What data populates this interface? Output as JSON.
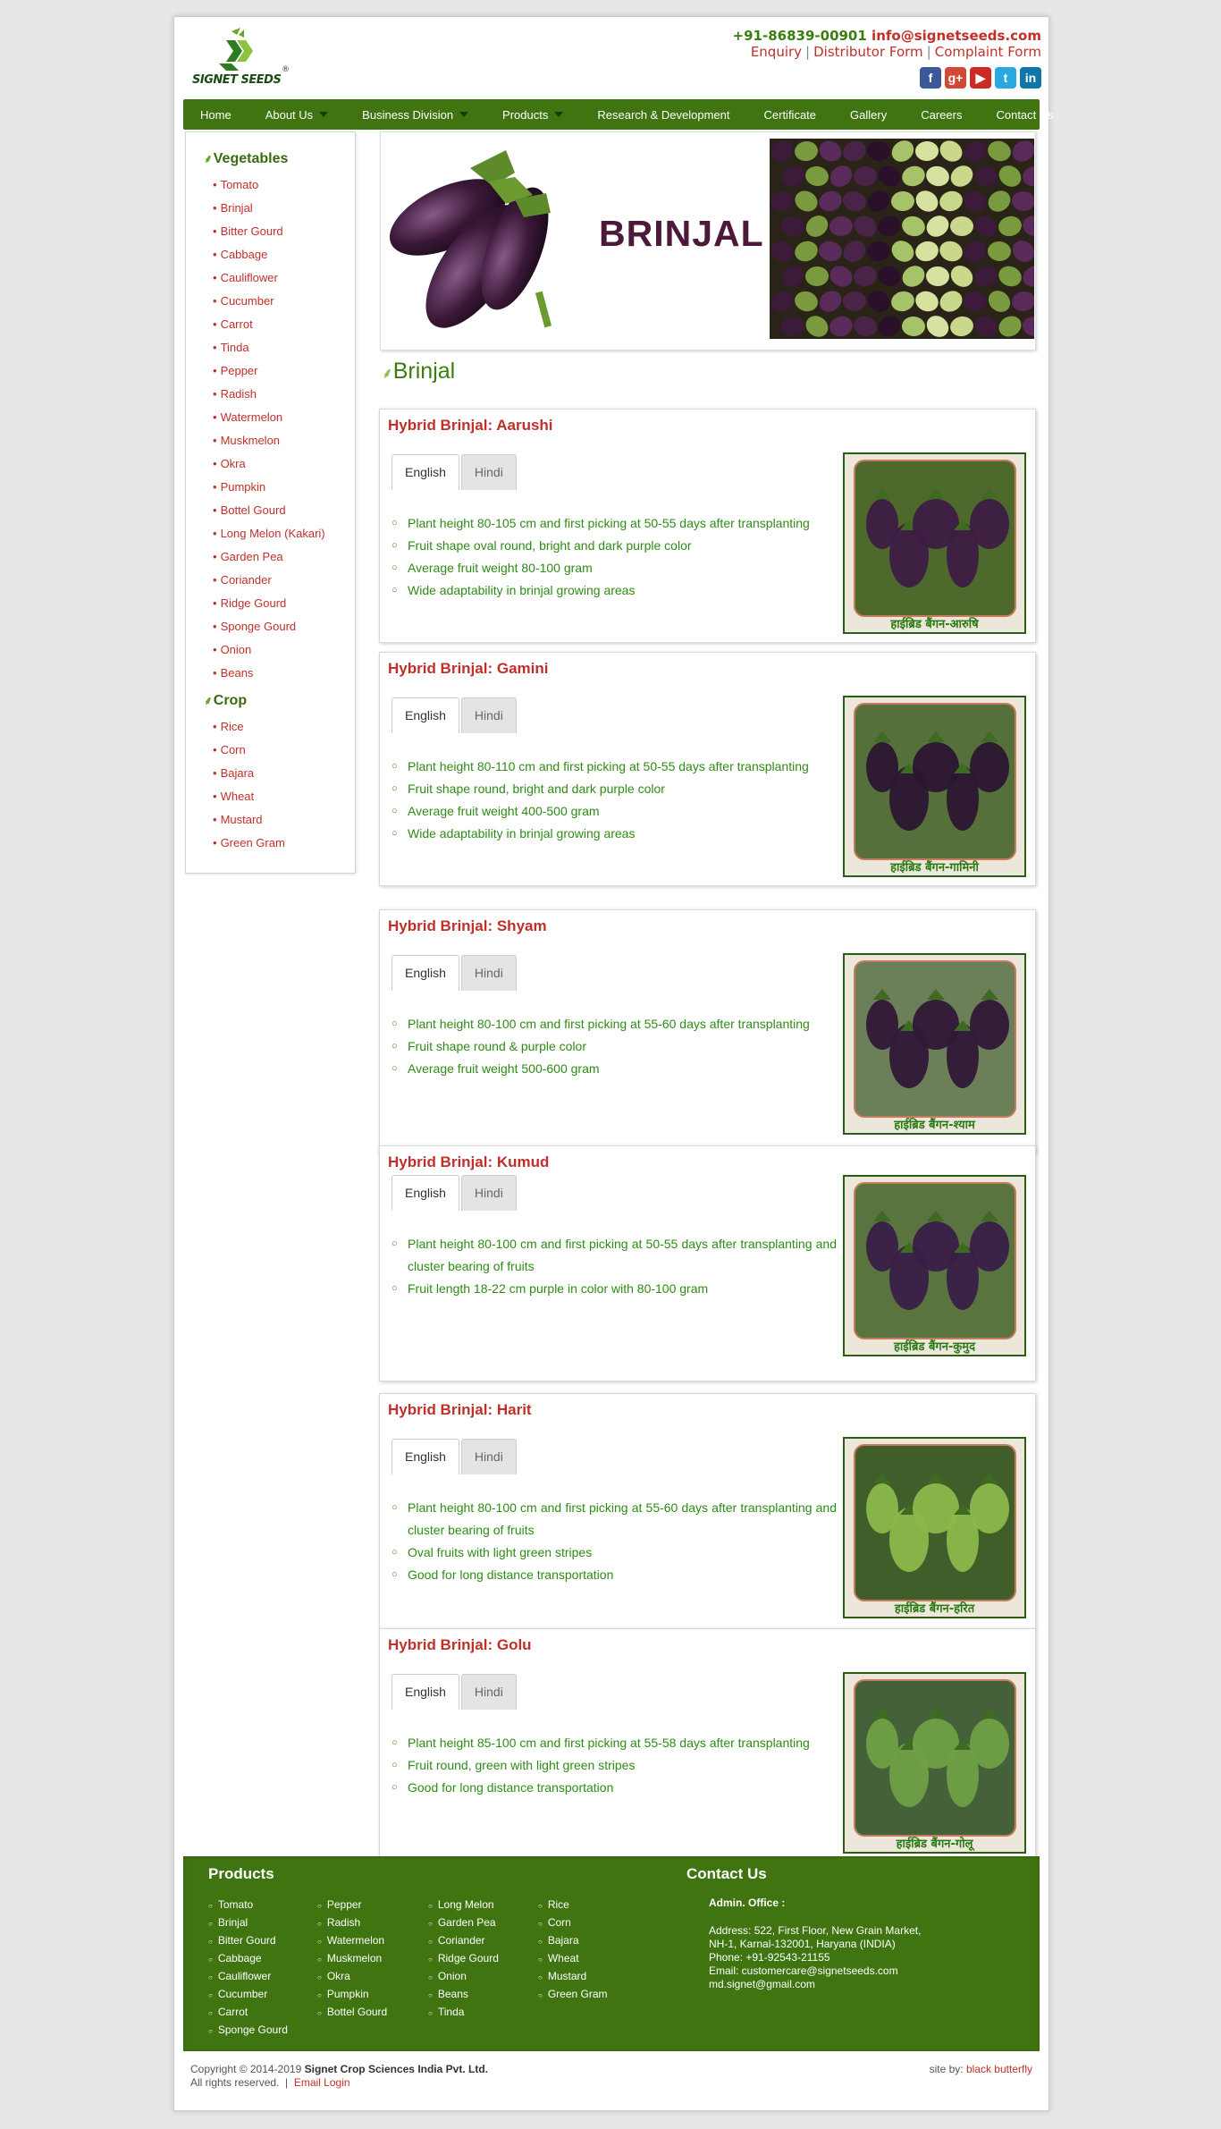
{
  "header": {
    "phone": "+91-86839-00901",
    "email": "info@signetseeds.com",
    "links": [
      "Enquiry",
      "Distributor Form",
      "Complaint Form"
    ],
    "logo_text": "SIGNET SEEDS",
    "socials": [
      {
        "icon": "facebook-icon",
        "glyph": "f",
        "color": "#3b5998"
      },
      {
        "icon": "google-plus-icon",
        "glyph": "g+",
        "color": "#d34836"
      },
      {
        "icon": "youtube-icon",
        "glyph": "▶",
        "color": "#cc2a24"
      },
      {
        "icon": "twitter-icon",
        "glyph": "t",
        "color": "#2aa9e0"
      },
      {
        "icon": "linkedin-icon",
        "glyph": "in",
        "color": "#0e76a8"
      }
    ]
  },
  "nav": [
    {
      "label": "Home",
      "dropdown": false
    },
    {
      "label": "About Us",
      "dropdown": true
    },
    {
      "label": "Business Division",
      "dropdown": true
    },
    {
      "label": "Products",
      "dropdown": true
    },
    {
      "label": "Research & Development",
      "dropdown": false
    },
    {
      "label": "Certificate",
      "dropdown": false
    },
    {
      "label": "Gallery",
      "dropdown": false
    },
    {
      "label": "Careers",
      "dropdown": false
    },
    {
      "label": "Contact Us",
      "dropdown": false
    }
  ],
  "sidebar": {
    "vegetables_title": "Vegetables",
    "vegetables": [
      "Tomato",
      "Brinjal",
      "Bitter Gourd",
      "Cabbage",
      "Cauliflower",
      "Cucumber",
      "Carrot",
      "Tinda",
      "Pepper",
      "Radish",
      "Watermelon",
      "Muskmelon",
      "Okra",
      "Pumpkin",
      "Bottel Gourd",
      "Long Melon (Kakari)",
      "Garden Pea",
      "Coriander",
      "Ridge Gourd",
      "Sponge Gourd",
      "Onion",
      "Beans"
    ],
    "crop_title": "Crop",
    "crops": [
      "Rice",
      "Corn",
      "Bajara",
      "Wheat",
      "Mustard",
      "Green Gram"
    ]
  },
  "banner": {
    "title": "BRINJAL"
  },
  "section_title": "Brinjal",
  "tabs": {
    "english": "English",
    "hindi": "Hindi"
  },
  "products": [
    {
      "title": "Hybrid Brinjal: Aarushi",
      "caption": "हाईब्रिड बैंगन-आरुषि",
      "fruit": "#3d1c44",
      "bg": "#4d6a2c",
      "features": [
        "Plant height 80-105 cm and first picking at 50-55 days after transplanting",
        "Fruit shape oval round, bright and dark purple color",
        "Average fruit weight 80-100 gram",
        "Wide adaptability in brinjal growing areas"
      ]
    },
    {
      "title": "Hybrid Brinjal: Gamini",
      "caption": "हाईब्रिड बैंगन-गामिनी",
      "fruit": "#2c1530",
      "bg": "#55703a",
      "features": [
        "Plant height 80-110 cm and first picking at 50-55 days after transplanting",
        "Fruit shape round, bright and dark purple color",
        "Average fruit weight 400-500 gram",
        "Wide adaptability in brinjal growing areas"
      ]
    },
    {
      "title": "Hybrid Brinjal: Shyam",
      "caption": "हाईब्रिड बैंगन-श्याम",
      "fruit": "#321838",
      "bg": "#6b7f58",
      "features": [
        "Plant height 80-100 cm and first picking at 55-60 days after transplanting",
        "Fruit shape round & purple color",
        "Average fruit weight 500-600 gram"
      ]
    },
    {
      "title": "Hybrid Brinjal: Kumud",
      "caption": "हाईब्रिड बैंगन-कुमुद",
      "fruit": "#3a1e48",
      "bg": "#5a7440",
      "features": [
        "Plant height 80-100 cm and first picking at 50-55 days after transplanting and cluster bearing of fruits",
        "Fruit length 18-22 cm purple in color with 80-100 gram"
      ]
    },
    {
      "title": "Hybrid Brinjal: Harit",
      "caption": "हाईब्रिड बैंगन-हरित",
      "fruit": "#8ab84a",
      "bg": "#3f5e2a",
      "features": [
        "Plant height 80-100 cm and first picking at 55-60 days after transplanting and cluster bearing of fruits",
        "Oval fruits with light green stripes",
        "Good for long distance transportation"
      ]
    },
    {
      "title": "Hybrid Brinjal: Golu",
      "caption": "हाईब्रिड बैंगन-गोलू",
      "fruit": "#6fa044",
      "bg": "#45613a",
      "features": [
        "Plant height 85-100 cm and first picking at 55-58 days after transplanting",
        "Fruit round, green with light green stripes",
        "Good for long distance transportation"
      ]
    }
  ],
  "footer": {
    "products_title": "Products",
    "columns": [
      [
        "Tomato",
        "Brinjal",
        "Bitter Gourd",
        "Cabbage",
        "Cauliflower",
        "Cucumber",
        "Carrot",
        "Sponge Gourd"
      ],
      [
        "Pepper",
        "Radish",
        "Watermelon",
        "Muskmelon",
        "Okra",
        "Pumpkin",
        "Bottel Gourd"
      ],
      [
        "Long Melon",
        "Garden Pea",
        "Coriander",
        "Ridge Gourd",
        "Onion",
        "Beans",
        "Tinda"
      ],
      [
        "Rice",
        "Corn",
        "Bajara",
        "Wheat",
        "Mustard",
        "Green Gram"
      ]
    ],
    "contact_title": "Contact Us",
    "office_label": "Admin. Office :",
    "address": [
      "Address: 522, First Floor, New Grain Market,",
      "NH-1, Karnal-132001, Haryana (INDIA)",
      "Phone: +91-92543-21155",
      "Email: customercare@signetseeds.com",
      "md.signet@gmail.com"
    ]
  },
  "bottom": {
    "copyright_prefix": "Copyright © 2014-2019",
    "company": "Signet Crop Sciences India Pvt. Ltd.",
    "rights": "All rights reserved.",
    "email_login": "Email Login",
    "site_by_label": "site by:",
    "site_by": "black butterfly"
  },
  "colors": {
    "brand_green": "#3f7411",
    "accent_red": "#c0302b",
    "feature_green": "#2e8b16"
  }
}
